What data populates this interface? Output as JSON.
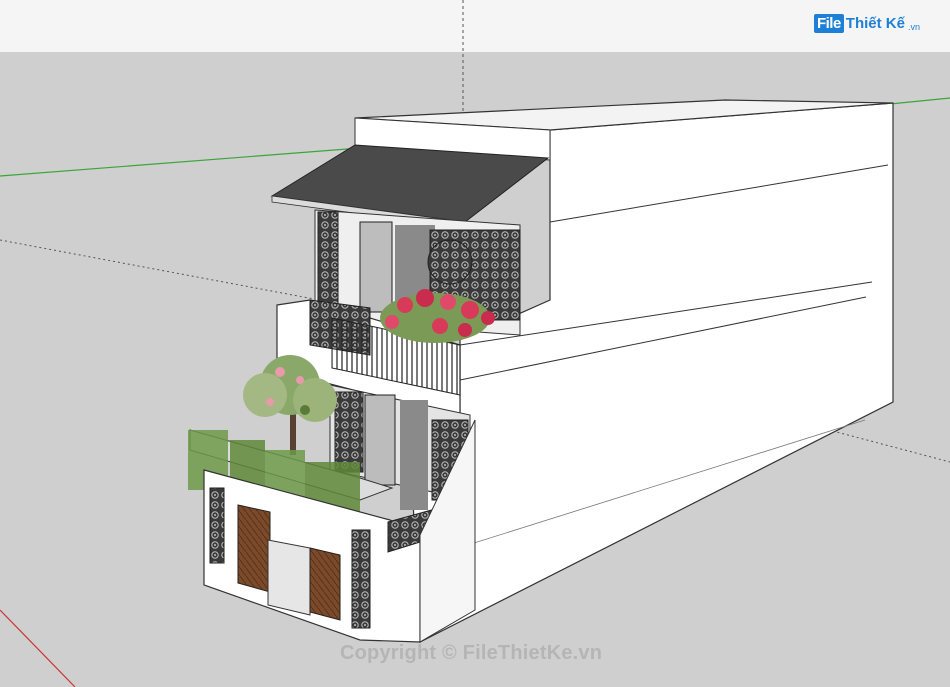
{
  "logo": {
    "mark": "File",
    "text": "Thiết Kế",
    "suffix": ".vn"
  },
  "watermark": {
    "text": "Copyright © FileThietKe.vn"
  },
  "colors": {
    "ground": "#cfcfcf",
    "sky": "#f5f5f5",
    "green_axis": "#3aa53a",
    "red_axis": "#cc3333",
    "building": "#ffffff",
    "roof": "#4a4a4a",
    "lattice": "#2a2a2a",
    "flowers": "#d83a5a",
    "foliage": "#6f9a4a"
  }
}
